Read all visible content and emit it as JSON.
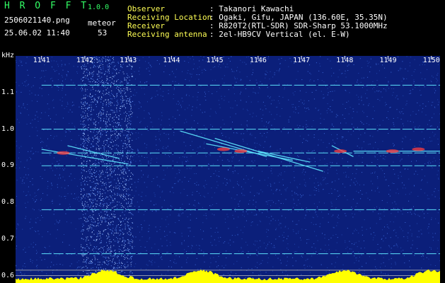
{
  "header": {
    "app_name": "H R O F F T",
    "version": "1.0.0",
    "filename": "2506021140.png",
    "datetime": "25.06.02 11:40",
    "detect_label": "meteor",
    "detect_count": "53",
    "info": [
      {
        "label": "Observer",
        "value": ": Takanori Kawachi"
      },
      {
        "label": "Receiving Location",
        "value": ": Ogaki, Gifu, JAPAN (136.60E, 35.35N)"
      },
      {
        "label": "Receiver",
        "value": ": R820T2(RTL-SDR) SDR-Sharp 53.1000MHz"
      },
      {
        "label": "Receiving antenna",
        "value": ": 2el-HB9CV Vertical (el. E-W)"
      }
    ]
  },
  "colors": {
    "background": "#0b1f7a",
    "header_green": "#33ff66",
    "header_yellow": "#ffff55",
    "signal_cyan": "#5fe8ff",
    "signal_hot": "#ff4040",
    "power_yellow": "#ffff00"
  },
  "chart_data": {
    "type": "heatmap",
    "ylabel": "kHz",
    "y_ticks": [
      "1.1",
      "1.0",
      "0.9",
      "0.8",
      "0.7",
      "0.6"
    ],
    "x_ticks": [
      "1141",
      "1142",
      "1143",
      "1144",
      "1145",
      "1146",
      "1147",
      "1148",
      "1149",
      "1150"
    ],
    "y_range_khz": [
      0.58,
      1.2
    ],
    "x_range_min": [
      1140.4,
      1150.2
    ],
    "carriers_khz": [
      1.12,
      1.0,
      0.935,
      0.9,
      0.78,
      0.66
    ]
  }
}
